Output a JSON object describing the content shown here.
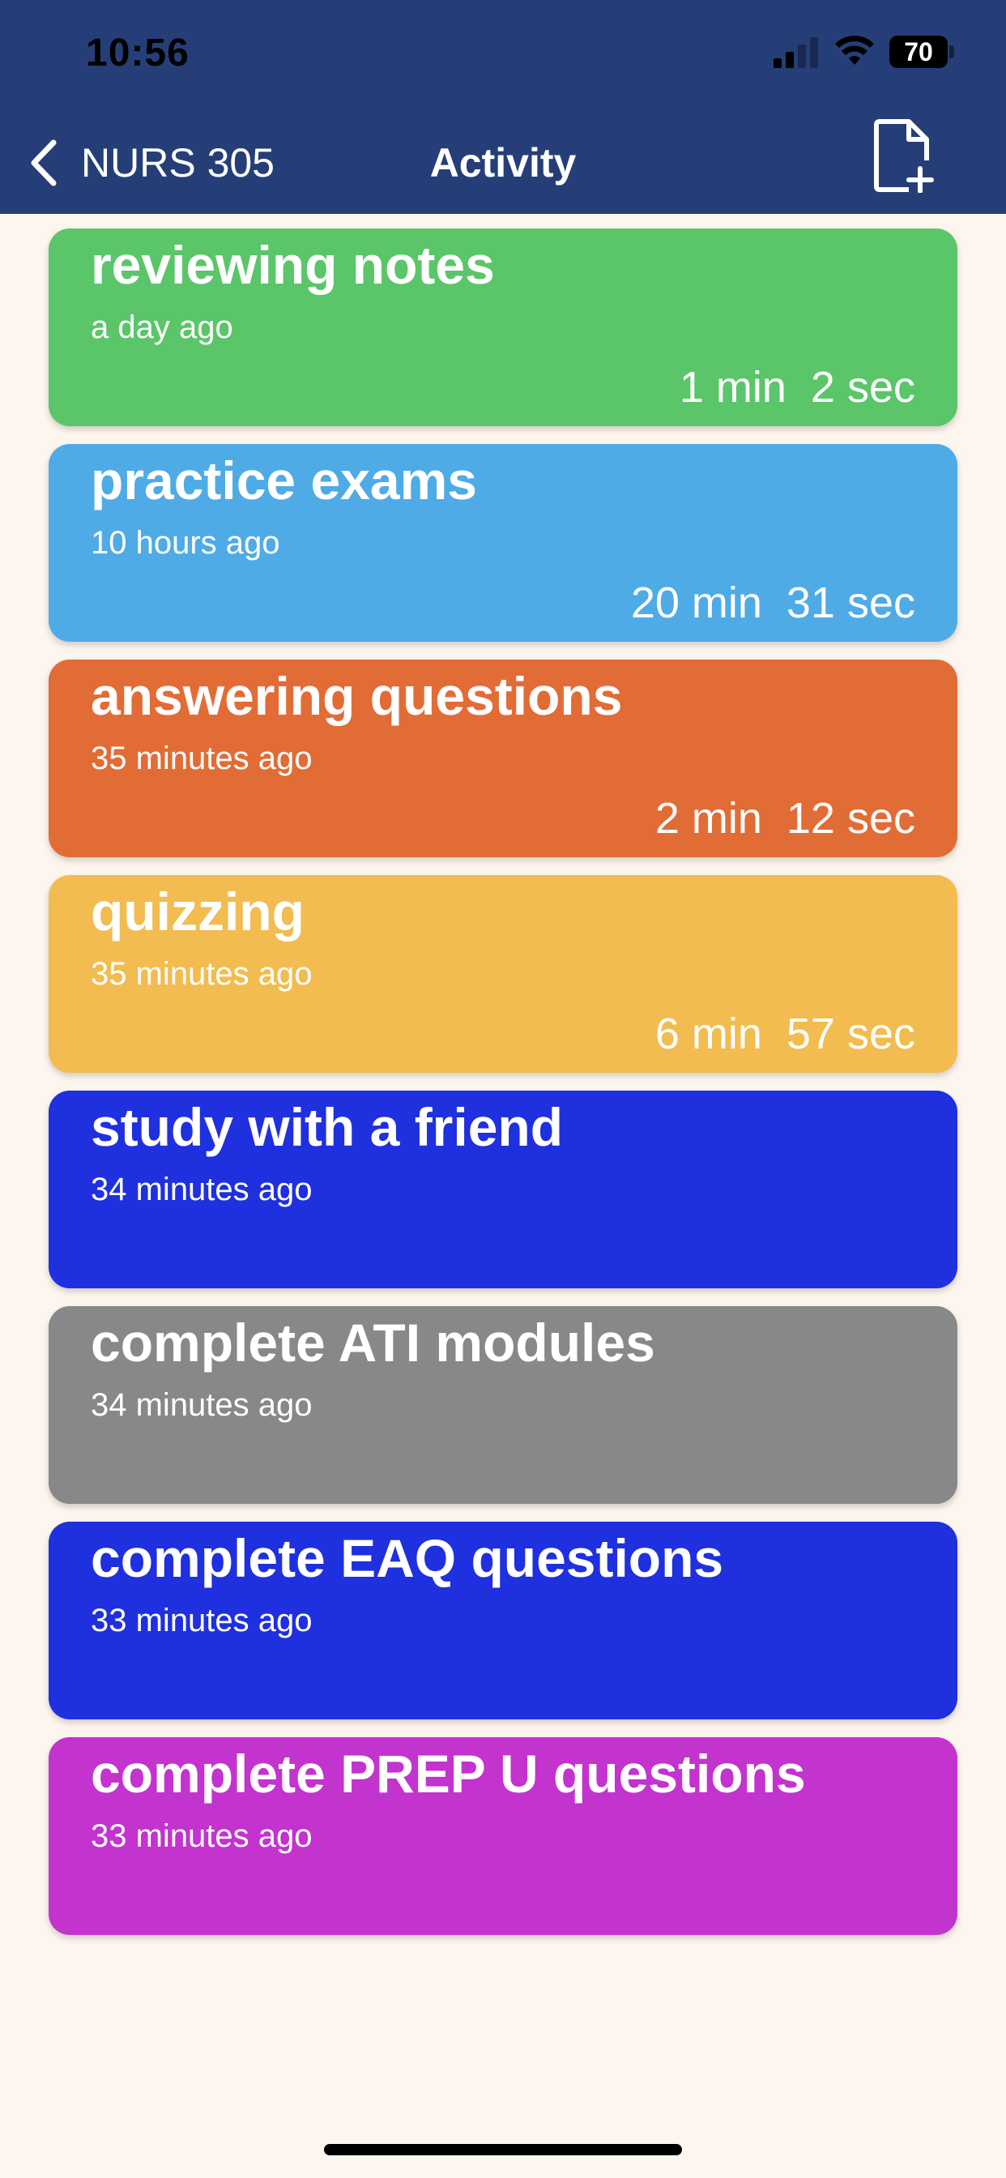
{
  "status_bar": {
    "time": "10:56",
    "battery": "70"
  },
  "nav": {
    "back_label": "NURS 305",
    "title": "Activity"
  },
  "colors": {
    "header": "#263e78",
    "background": "#fdf6ee"
  },
  "activities": [
    {
      "title": "reviewing notes",
      "time_ago": "a day ago",
      "duration": "1 min  2 sec",
      "color": "#5bc56a"
    },
    {
      "title": "practice exams",
      "time_ago": "10 hours ago",
      "duration": "20 min  31 sec",
      "color": "#4fabe6"
    },
    {
      "title": "answering questions",
      "time_ago": "35 minutes ago",
      "duration": "2 min  12 sec",
      "color": "#e26c36"
    },
    {
      "title": "quizzing",
      "time_ago": "35 minutes ago",
      "duration": "6 min  57 sec",
      "color": "#f2bc50"
    },
    {
      "title": "study with a friend",
      "time_ago": "34 minutes ago",
      "duration": "",
      "color": "#1f30de"
    },
    {
      "title": "complete ATI modules",
      "time_ago": "34 minutes ago",
      "duration": "",
      "color": "#888888"
    },
    {
      "title": "complete EAQ questions",
      "time_ago": "33 minutes ago",
      "duration": "",
      "color": "#1f30de"
    },
    {
      "title": "complete PREP U questions",
      "time_ago": "33 minutes ago",
      "duration": "",
      "color": "#c333ce"
    }
  ]
}
